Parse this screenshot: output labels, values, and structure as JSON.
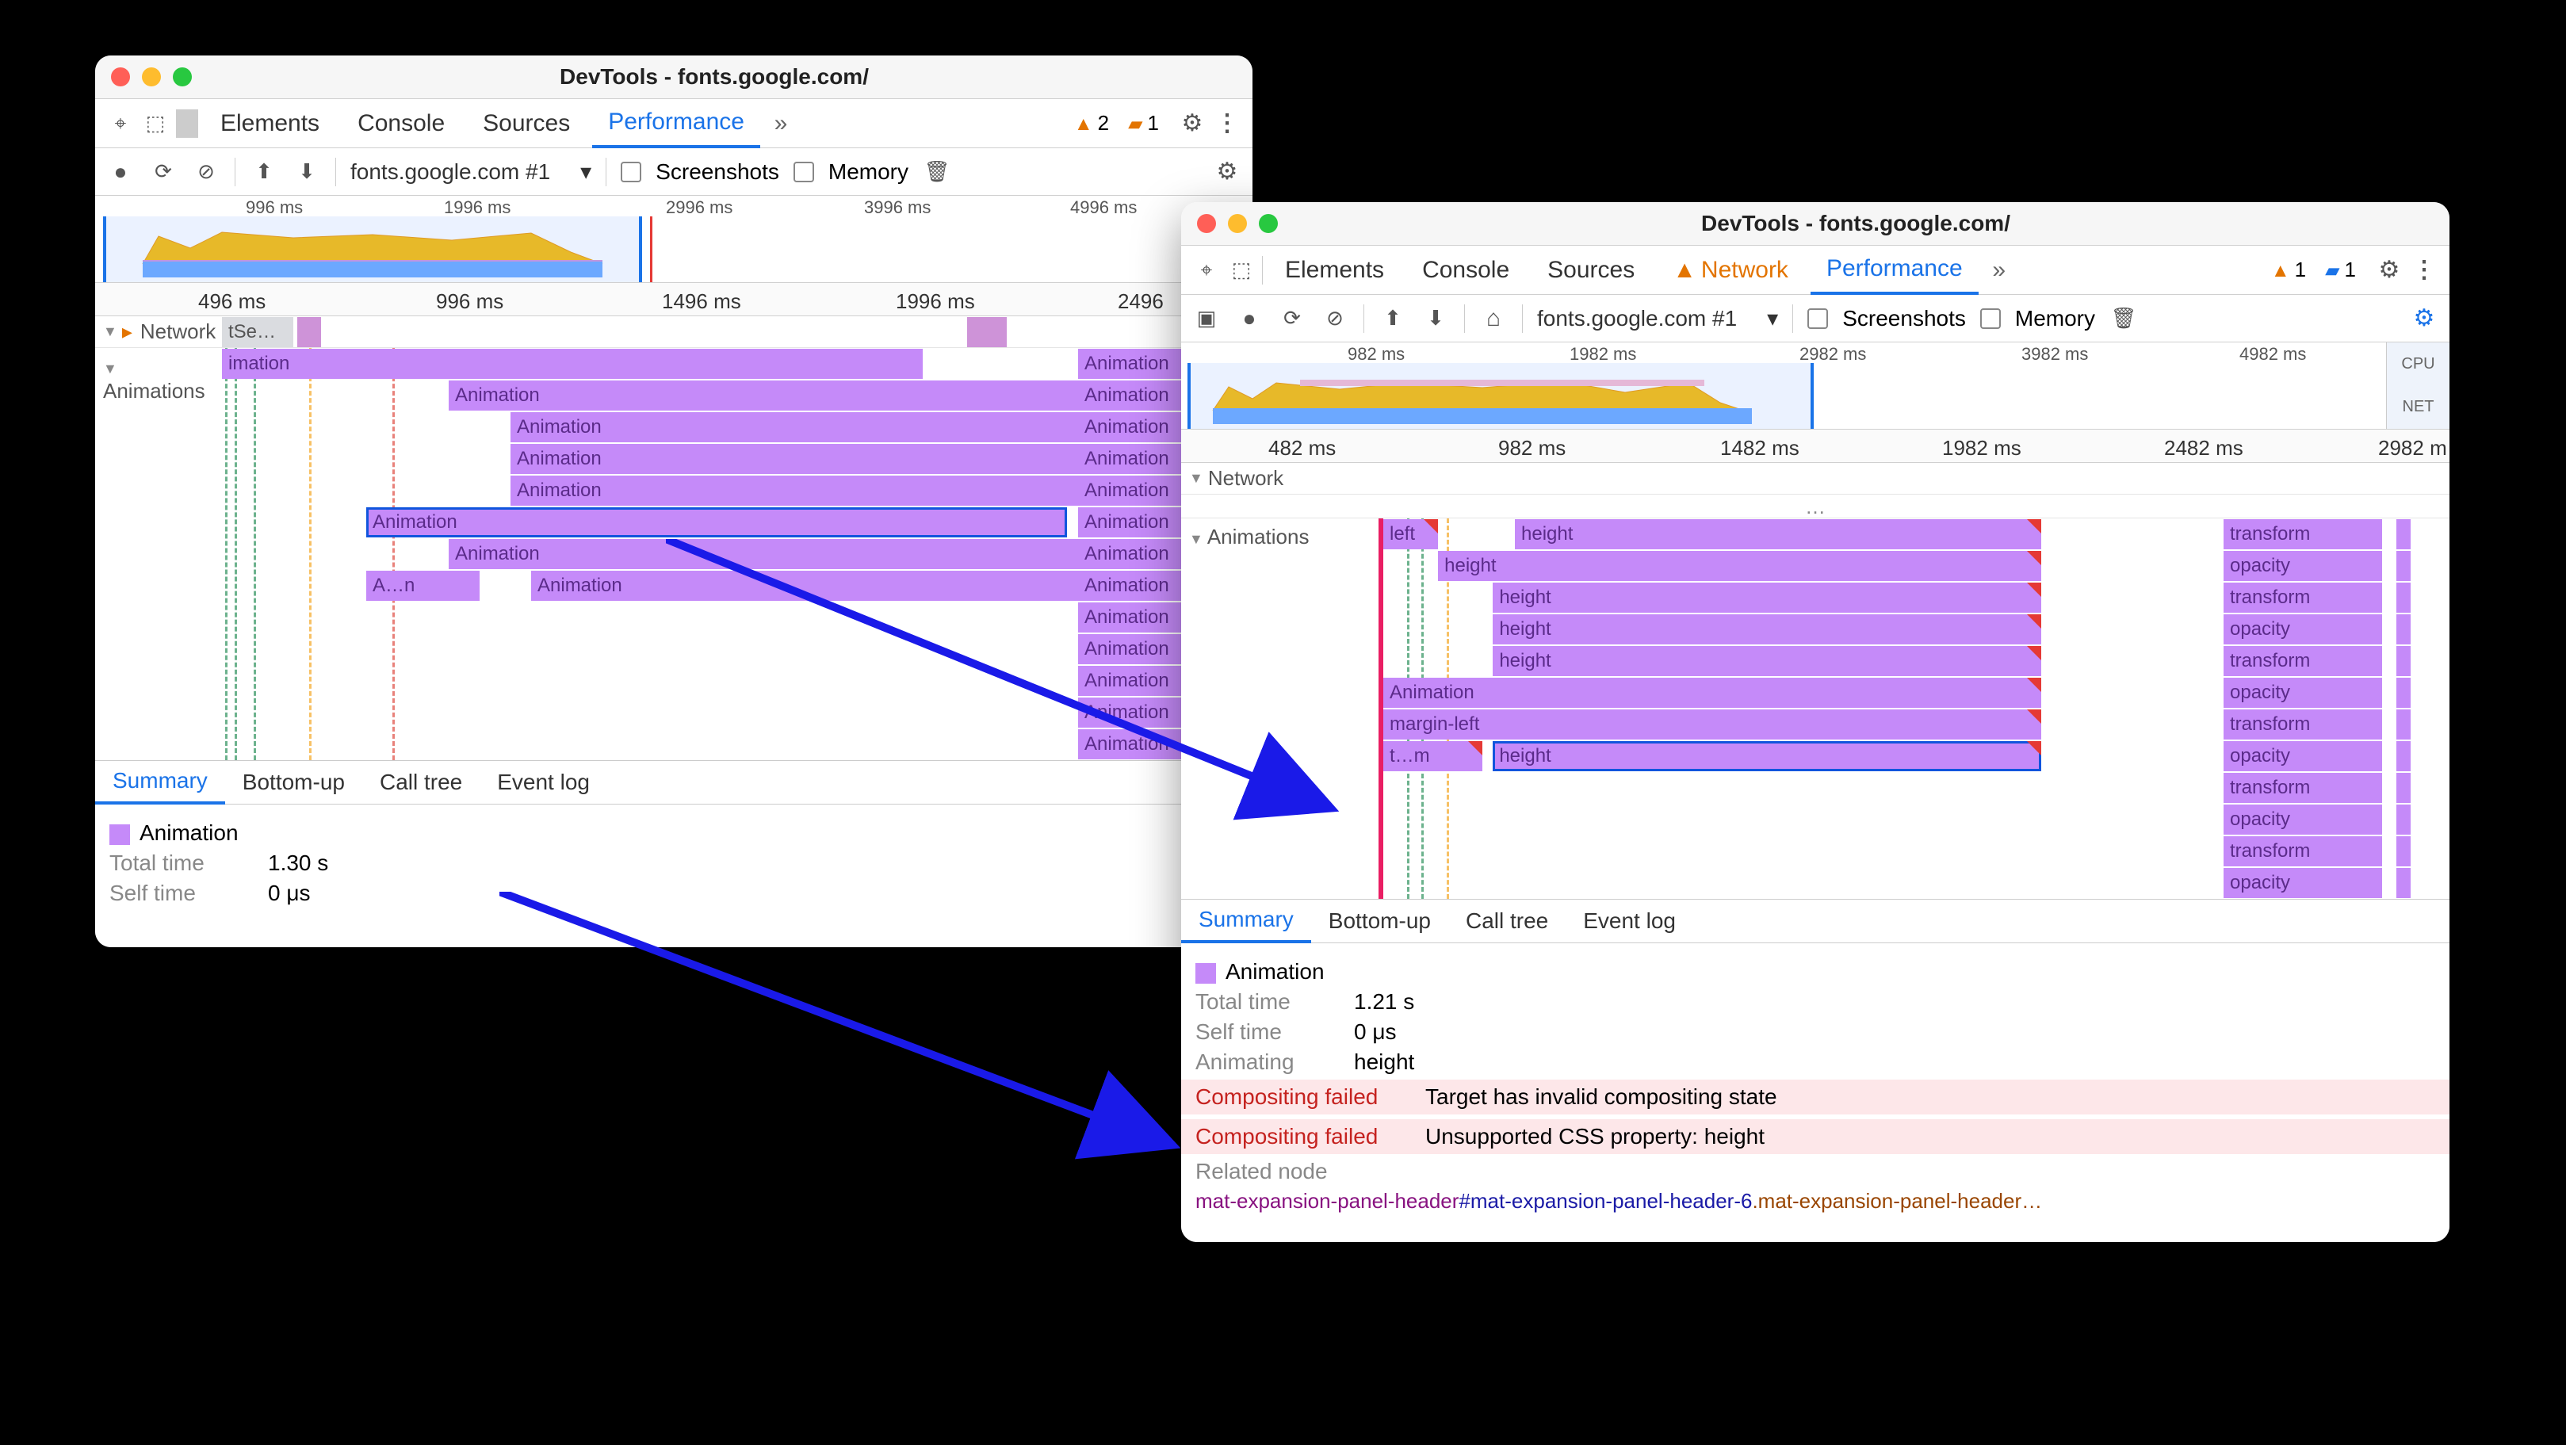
{
  "windowA": {
    "title": "DevTools - fonts.google.com/",
    "tabs": {
      "elements": "Elements",
      "console": "Console",
      "sources": "Sources",
      "performance": "Performance"
    },
    "badges": {
      "warn": "2",
      "issue": "1"
    },
    "toolbar": {
      "target": "fonts.google.com #1",
      "screenshots": "Screenshots",
      "memory": "Memory"
    },
    "overview_ticks": [
      "996 ms",
      "1996 ms",
      "2996 ms",
      "3996 ms",
      "4996 ms"
    ],
    "ruler_ticks": [
      "496 ms",
      "996 ms",
      "1496 ms",
      "1996 ms",
      "2496"
    ],
    "network_label": "Network",
    "net_seg": "tSe…",
    "anim_label": "Animations",
    "anim_first": "imation",
    "rows": [
      {
        "bars": [
          {
            "l": 22,
            "w": 68,
            "t": "Animation"
          }
        ],
        "right": "Animation"
      },
      {
        "bars": [
          {
            "l": 28,
            "w": 63,
            "t": "Animation"
          }
        ],
        "right": "Animation"
      },
      {
        "bars": [
          {
            "l": 28,
            "w": 63,
            "t": "Animation"
          }
        ],
        "right": "Animation"
      },
      {
        "bars": [
          {
            "l": 28,
            "w": 63,
            "t": "Animation"
          }
        ],
        "right": "Animation"
      },
      {
        "bars": [
          {
            "l": 14,
            "w": 68,
            "t": "Animation",
            "sel": true
          }
        ],
        "right": "Animation"
      },
      {
        "bars": [
          {
            "l": 22,
            "w": 68,
            "t": "Animation"
          }
        ],
        "right": "Animation"
      },
      {
        "bars": [
          {
            "l": 14,
            "w": 11,
            "t": "A…n"
          },
          {
            "l": 30,
            "w": 60,
            "t": "Animation"
          }
        ],
        "right": "Animation"
      },
      {
        "bars": [],
        "right": "Animation"
      },
      {
        "bars": [],
        "right": "Animation"
      },
      {
        "bars": [],
        "right": "Animation"
      },
      {
        "bars": [],
        "right": "Animation"
      },
      {
        "bars": [],
        "right": "Animation"
      }
    ],
    "dtabs": {
      "summary": "Summary",
      "bottomup": "Bottom-up",
      "calltree": "Call tree",
      "eventlog": "Event log"
    },
    "summary": {
      "title": "Animation",
      "total_l": "Total time",
      "total_v": "1.30 s",
      "self_l": "Self time",
      "self_v": "0 μs"
    }
  },
  "windowB": {
    "title": "DevTools - fonts.google.com/",
    "tabs": {
      "elements": "Elements",
      "console": "Console",
      "sources": "Sources",
      "network": "Network",
      "performance": "Performance"
    },
    "badges": {
      "warn": "1",
      "issue": "1"
    },
    "toolbar": {
      "target": "fonts.google.com #1",
      "screenshots": "Screenshots",
      "memory": "Memory"
    },
    "overview_ticks": [
      "982 ms",
      "1982 ms",
      "2982 ms",
      "3982 ms",
      "4982 ms"
    ],
    "ov_side": {
      "cpu": "CPU",
      "net": "NET"
    },
    "ruler_ticks": [
      "482 ms",
      "982 ms",
      "1482 ms",
      "1982 ms",
      "2482 ms",
      "2982 m"
    ],
    "network_label": "Network",
    "anim_label": "Animations",
    "ellipsis": "…",
    "rows": [
      {
        "main": [
          {
            "l": 0,
            "w": 5,
            "t": "left",
            "c": true
          },
          {
            "l": 12,
            "w": 48,
            "t": "height",
            "c": true
          }
        ],
        "right": [
          "transform"
        ]
      },
      {
        "main": [
          {
            "l": 5,
            "w": 55,
            "t": "height",
            "c": true
          }
        ],
        "right": [
          "opacity"
        ]
      },
      {
        "main": [
          {
            "l": 10,
            "w": 50,
            "t": "height",
            "c": true
          }
        ],
        "right": [
          "transform"
        ]
      },
      {
        "main": [
          {
            "l": 10,
            "w": 50,
            "t": "height",
            "c": true
          }
        ],
        "right": [
          "opacity"
        ]
      },
      {
        "main": [
          {
            "l": 10,
            "w": 50,
            "t": "height",
            "c": true
          }
        ],
        "right": [
          "transform"
        ]
      },
      {
        "main": [
          {
            "l": 0,
            "w": 60,
            "t": "Animation",
            "c": true
          }
        ],
        "right": [
          "opacity"
        ]
      },
      {
        "main": [
          {
            "l": 0,
            "w": 60,
            "t": "margin-left",
            "c": true
          }
        ],
        "right": [
          "transform"
        ]
      },
      {
        "main": [
          {
            "l": 0,
            "w": 9,
            "t": "t…m",
            "c": true
          },
          {
            "l": 10,
            "w": 50,
            "t": "height",
            "c": true,
            "sel": true
          }
        ],
        "right": [
          "opacity"
        ]
      },
      {
        "main": [],
        "right": [
          "transform"
        ]
      },
      {
        "main": [],
        "right": [
          "opacity"
        ]
      },
      {
        "main": [],
        "right": [
          "transform"
        ]
      },
      {
        "main": [],
        "right": [
          "opacity"
        ]
      }
    ],
    "dtabs": {
      "summary": "Summary",
      "bottomup": "Bottom-up",
      "calltree": "Call tree",
      "eventlog": "Event log"
    },
    "summary": {
      "title": "Animation",
      "total_l": "Total time",
      "total_v": "1.21 s",
      "self_l": "Self time",
      "self_v": "0 μs",
      "animating_l": "Animating",
      "animating_v": "height",
      "cf": "Compositing failed",
      "cf1": "Target has invalid compositing state",
      "cf2": "Unsupported CSS property: height",
      "related_l": "Related node",
      "node_tag": "mat-expansion-panel-header",
      "node_id": "#mat-expansion-panel-header-6",
      "node_cls": ".mat-expansion-panel-header…"
    }
  }
}
